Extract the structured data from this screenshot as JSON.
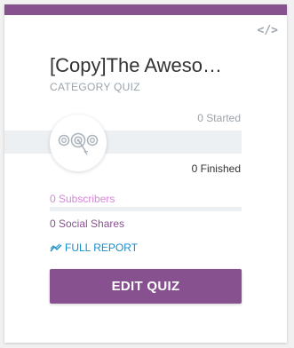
{
  "card": {
    "accent_color": "#87508e",
    "embed_icon": "code-icon",
    "embed_glyph": "</>",
    "title": "[Copy]The Aweso…",
    "category": "CATEGORY QUIZ",
    "quiz_icon": "target-icon",
    "stats": {
      "started": "0 Started",
      "finished": "0 Finished",
      "subscribers": "0 Subscribers",
      "social_shares": "0 Social Shares"
    },
    "report_icon": "trend-line-icon",
    "report_label": "FULL REPORT",
    "edit_button_label": "EDIT QUIZ"
  }
}
